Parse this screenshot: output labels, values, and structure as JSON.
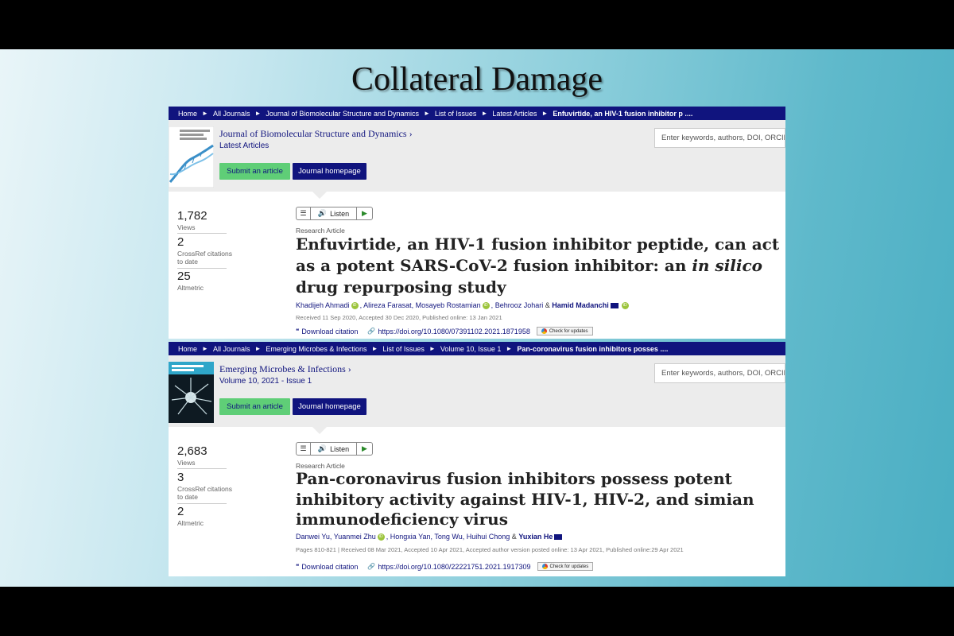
{
  "slide": {
    "title": "Collateral Damage"
  },
  "articles": [
    {
      "breadcrumb": [
        "Home",
        "All Journals",
        "Journal of Biomolecular Structure and Dynamics",
        "List of Issues",
        "Latest Articles",
        "Enfuvirtide, an HIV-1 fusion inhibitor p ...."
      ],
      "journal_title": "Journal of Biomolecular Structure and Dynamics",
      "journal_sub": "Latest Articles",
      "journal_sub_issue": "",
      "submit_label": "Submit an article",
      "homepage_label": "Journal homepage",
      "search_placeholder": "Enter keywords, authors, DOI, ORCID",
      "views": "1,782",
      "views_label": "Views",
      "crossref": "2",
      "crossref_label": "CrossRef citations to date",
      "altmetric": "25",
      "altmetric_label": "Altmetric",
      "listen_label": "Listen",
      "type": "Research Article",
      "title_a": "Enfuvirtide, an HIV-1 fusion inhibitor peptide, can act as a potent SARS-CoV-2 fusion inhibitor: an ",
      "title_italic": "in silico",
      "title_b": " drug repurposing study",
      "authors": [
        "Khadijeh Ahmadi",
        "Alireza Farasat",
        "Mosayeb Rostamian",
        "Behrooz Johari"
      ],
      "corresponding": "Hamid Madanchi",
      "dates": "Received 11 Sep 2020, Accepted 30 Dec 2020, Published online: 13 Jan 2021",
      "download_label": "Download citation",
      "doi": "https://doi.org/10.1080/07391102.2021.1871958",
      "check_label": "Check for updates"
    },
    {
      "breadcrumb": [
        "Home",
        "All Journals",
        "Emerging Microbes & Infections",
        "List of Issues",
        "Volume 10, Issue 1",
        "Pan-coronavirus fusion inhibitors posses ...."
      ],
      "journal_title": "Emerging Microbes & Infections",
      "journal_sub": "Volume 10, 2021 - ",
      "journal_sub_issue": "Issue 1",
      "submit_label": "Submit an article",
      "homepage_label": "Journal homepage",
      "search_placeholder": "Enter keywords, authors, DOI, ORCID",
      "views": "2,683",
      "views_label": "Views",
      "crossref": "3",
      "crossref_label": "CrossRef citations to date",
      "altmetric": "2",
      "altmetric_label": "Altmetric",
      "listen_label": "Listen",
      "type": "Research Article",
      "title_a": "Pan-coronavirus fusion inhibitors possess potent inhibitory activity against HIV-1, HIV-2, and simian immunodeficiency virus",
      "title_italic": "",
      "title_b": "",
      "authors": [
        "Danwei Yu",
        "Yuanmei Zhu",
        "Hongxia Yan",
        "Tong Wu",
        "Huihui Chong"
      ],
      "corresponding": "Yuxian He",
      "dates": "Pages 810-821 | Received 08 Mar 2021, Accepted 10 Apr 2021, Accepted author version posted online: 13 Apr 2021, Published online:29 Apr 2021",
      "download_label": "Download citation",
      "doi": "https://doi.org/10.1080/22221751.2021.1917309",
      "check_label": "Check for updates"
    }
  ],
  "colors": {
    "navy": "#10147e",
    "green": "#5fce77"
  }
}
